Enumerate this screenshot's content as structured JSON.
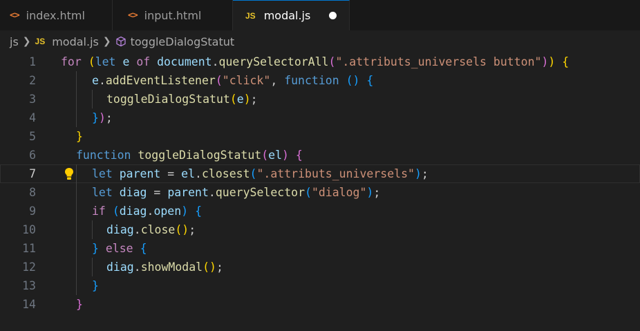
{
  "tabs": [
    {
      "label": "index.html",
      "icon": "html-file-icon",
      "active": false
    },
    {
      "label": "input.html",
      "icon": "html-file-icon",
      "active": false
    },
    {
      "label": "modal.js",
      "icon": "js-file-icon",
      "active": true,
      "unsaved": true
    }
  ],
  "tab_icon_text": {
    "html": "<>",
    "js": "JS"
  },
  "breadcrumb": {
    "folder": "js",
    "file": "modal.js",
    "symbol": "toggleDialogStatut"
  },
  "editor": {
    "current_line": 7,
    "line_numbers": [
      "1",
      "2",
      "3",
      "4",
      "5",
      "6",
      "7",
      "8",
      "9",
      "10",
      "11",
      "12",
      "13",
      "14"
    ],
    "lines": [
      [
        [
          "kw",
          "for"
        ],
        [
          "pn",
          " "
        ],
        [
          "b1",
          "("
        ],
        [
          "st",
          "let"
        ],
        [
          "pn",
          " "
        ],
        [
          "var",
          "e"
        ],
        [
          "pn",
          " "
        ],
        [
          "kw",
          "of"
        ],
        [
          "pn",
          " "
        ],
        [
          "var",
          "document"
        ],
        [
          "pn",
          "."
        ],
        [
          "fn",
          "querySelectorAll"
        ],
        [
          "b2",
          "("
        ],
        [
          "str",
          "\".attributs_universels button\""
        ],
        [
          "b2",
          ")"
        ],
        [
          "b1",
          ")"
        ],
        [
          "pn",
          " "
        ],
        [
          "b1",
          "{"
        ]
      ],
      [
        [
          "var",
          "e"
        ],
        [
          "pn",
          "."
        ],
        [
          "fn",
          "addEventListener"
        ],
        [
          "b2",
          "("
        ],
        [
          "str",
          "\"click\""
        ],
        [
          "pn",
          ", "
        ],
        [
          "st",
          "function"
        ],
        [
          "pn",
          " "
        ],
        [
          "b3",
          "()"
        ],
        [
          "pn",
          " "
        ],
        [
          "b3",
          "{"
        ]
      ],
      [
        [
          "fn",
          "toggleDialogStatut"
        ],
        [
          "b1",
          "("
        ],
        [
          "var",
          "e"
        ],
        [
          "b1",
          ")"
        ],
        [
          "pn",
          ";"
        ]
      ],
      [
        [
          "b3",
          "}"
        ],
        [
          "b2",
          ")"
        ],
        [
          "pn",
          ";"
        ]
      ],
      [
        [
          "b1",
          "}"
        ]
      ],
      [
        [
          "st",
          "function"
        ],
        [
          "pn",
          " "
        ],
        [
          "fn",
          "toggleDialogStatut"
        ],
        [
          "b2",
          "("
        ],
        [
          "var",
          "el"
        ],
        [
          "b2",
          ")"
        ],
        [
          "pn",
          " "
        ],
        [
          "b2",
          "{"
        ]
      ],
      [
        [
          "st",
          "let"
        ],
        [
          "pn",
          " "
        ],
        [
          "var",
          "parent"
        ],
        [
          "pn",
          " = "
        ],
        [
          "var",
          "el"
        ],
        [
          "pn",
          "."
        ],
        [
          "fn",
          "closest"
        ],
        [
          "b3",
          "("
        ],
        [
          "str",
          "\".attributs_universels\""
        ],
        [
          "b3",
          ")"
        ],
        [
          "pn",
          ";"
        ]
      ],
      [
        [
          "st",
          "let"
        ],
        [
          "pn",
          " "
        ],
        [
          "var",
          "diag"
        ],
        [
          "pn",
          " = "
        ],
        [
          "var",
          "parent"
        ],
        [
          "pn",
          "."
        ],
        [
          "fn",
          "querySelector"
        ],
        [
          "b3",
          "("
        ],
        [
          "str",
          "\"dialog\""
        ],
        [
          "b3",
          ")"
        ],
        [
          "pn",
          ";"
        ]
      ],
      [
        [
          "kw",
          "if"
        ],
        [
          "pn",
          " "
        ],
        [
          "b3",
          "("
        ],
        [
          "var",
          "diag"
        ],
        [
          "pn",
          "."
        ],
        [
          "var",
          "open"
        ],
        [
          "b3",
          ")"
        ],
        [
          "pn",
          " "
        ],
        [
          "b3",
          "{"
        ]
      ],
      [
        [
          "var",
          "diag"
        ],
        [
          "pn",
          "."
        ],
        [
          "fn",
          "close"
        ],
        [
          "b1",
          "()"
        ],
        [
          "pn",
          ";"
        ]
      ],
      [
        [
          "b3",
          "}"
        ],
        [
          "pn",
          " "
        ],
        [
          "kw",
          "else"
        ],
        [
          "pn",
          " "
        ],
        [
          "b3",
          "{"
        ]
      ],
      [
        [
          "var",
          "diag"
        ],
        [
          "pn",
          "."
        ],
        [
          "fn",
          "showModal"
        ],
        [
          "b1",
          "()"
        ],
        [
          "pn",
          ";"
        ]
      ],
      [
        [
          "b3",
          "}"
        ]
      ],
      [
        [
          "b2",
          "}"
        ]
      ]
    ]
  },
  "colors": {
    "background": "#1f1f1f",
    "keyword": "#c586c0",
    "storage": "#569cd6",
    "variable": "#9cdcfe",
    "function": "#dcdcaa",
    "string": "#ce9178",
    "bracket_gold": "#ffd700",
    "bracket_orchid": "#da70d6",
    "bracket_blue": "#179fff",
    "html_icon": "#e37933",
    "js_icon": "#e8c32a",
    "lightbulb": "#ffcc00"
  }
}
